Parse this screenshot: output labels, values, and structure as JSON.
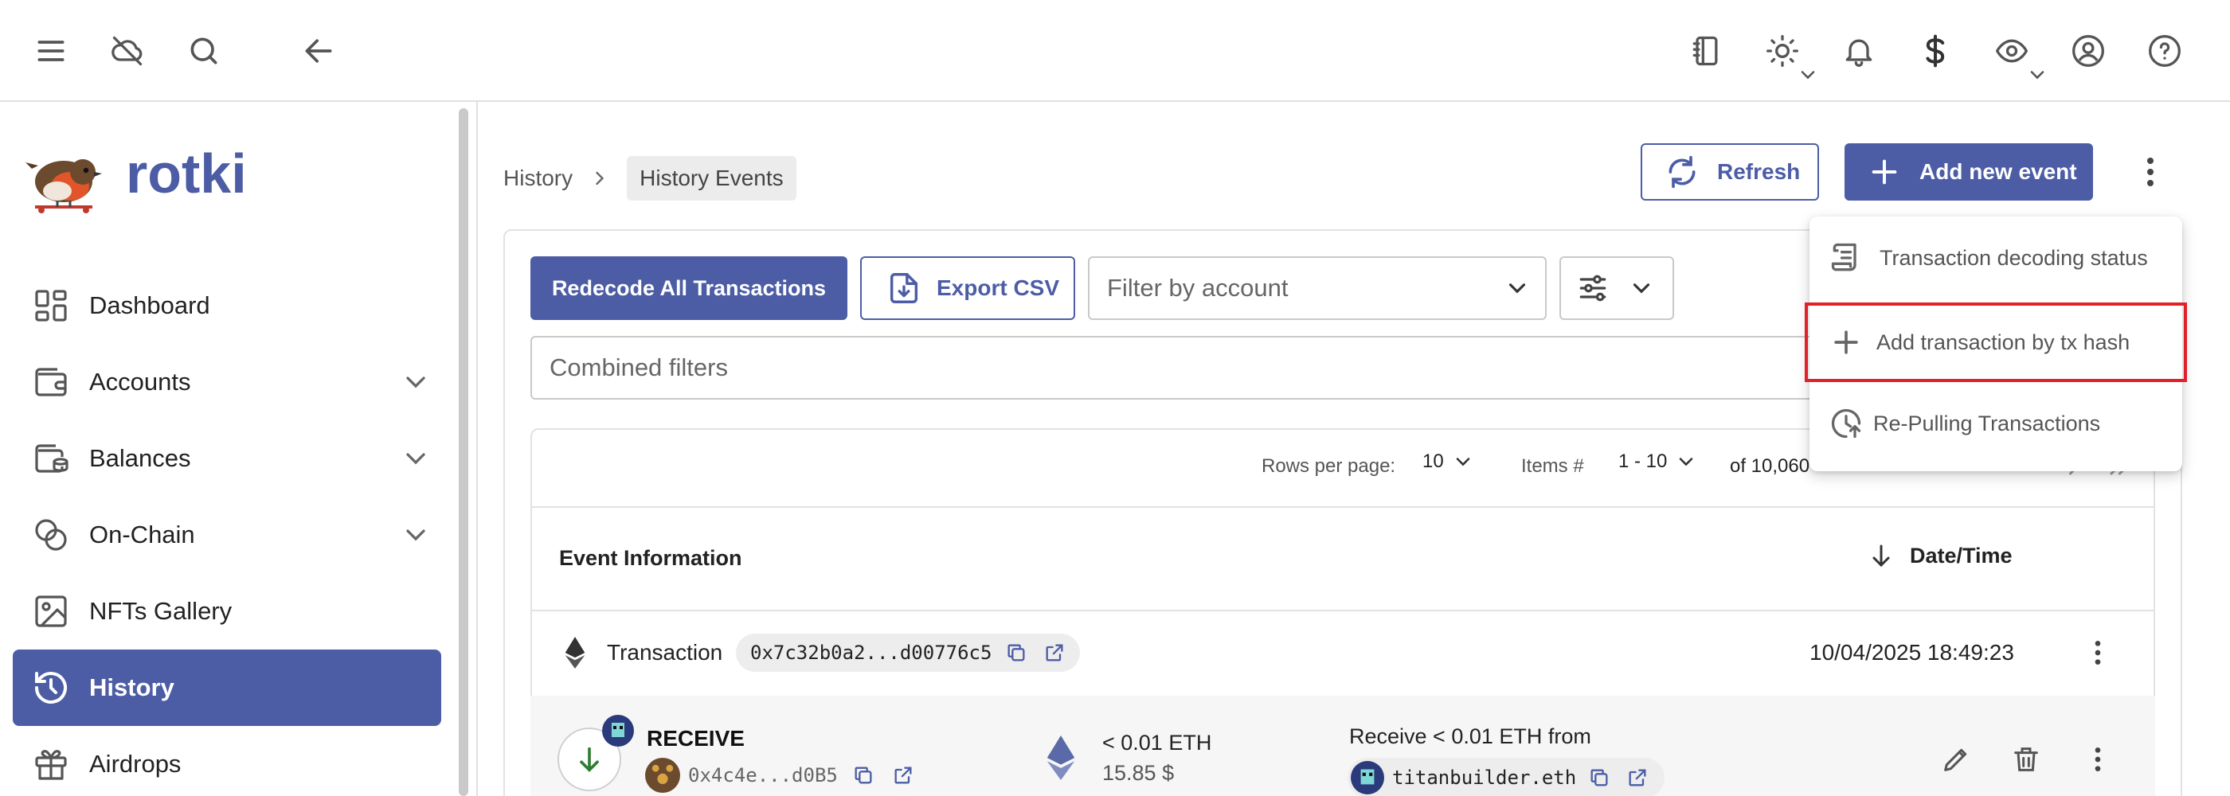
{
  "app": {
    "name": "rotki"
  },
  "topbar": {
    "icons": [
      "menu-icon",
      "cloud-off-icon",
      "search-icon",
      "back-arrow-icon",
      "notes-icon",
      "theme-icon",
      "bell-icon",
      "currency-icon",
      "privacy-eye-icon",
      "account-icon",
      "help-icon"
    ]
  },
  "sidebar": {
    "items": [
      {
        "label": "Dashboard",
        "icon": "dashboard-icon",
        "expandable": false
      },
      {
        "label": "Accounts",
        "icon": "wallet-icon",
        "expandable": true
      },
      {
        "label": "Balances",
        "icon": "balances-icon",
        "expandable": true
      },
      {
        "label": "On-Chain",
        "icon": "coins-icon",
        "expandable": true
      },
      {
        "label": "NFTs Gallery",
        "icon": "image-icon",
        "expandable": false
      },
      {
        "label": "History",
        "icon": "history-icon",
        "expandable": false,
        "active": true
      },
      {
        "label": "Airdrops",
        "icon": "gift-icon",
        "expandable": false
      }
    ]
  },
  "breadcrumb": {
    "parent": "History",
    "current": "History Events"
  },
  "toolbar": {
    "refresh_label": "Refresh",
    "add_event_label": "Add new event"
  },
  "filters": {
    "redecode_label": "Redecode All Transactions",
    "export_label": "Export CSV",
    "account_placeholder": "Filter by account",
    "combined_placeholder": "Combined filters"
  },
  "pagination": {
    "rows_per_page_label": "Rows per page:",
    "rows_per_page_value": "10",
    "items_label": "Items #",
    "items_value": "1 - 10",
    "total": "of 10,060"
  },
  "table": {
    "col_event": "Event Information",
    "col_date": "Date/Time",
    "group": {
      "type_label": "Transaction",
      "hash": "0x7c32b0a2...d00776c5",
      "datetime": "10/04/2025 18:49:23"
    },
    "event": {
      "type": "RECEIVE",
      "address": "0x4c4e...d0B5",
      "amount": "< 0.01 ETH",
      "value": "15.85 $",
      "description": "Receive < 0.01 ETH from",
      "counterparty": "titanbuilder.eth"
    }
  },
  "menu": {
    "items": [
      {
        "label": "Transaction decoding status",
        "icon": "receipt-icon"
      },
      {
        "label": "Add transaction by tx hash",
        "icon": "plus-icon",
        "highlighted": true
      },
      {
        "label": "Re-Pulling Transactions",
        "icon": "history-refresh-icon"
      }
    ]
  },
  "colors": {
    "accent": "#4c5da6",
    "highlight_border": "#e2202a"
  }
}
